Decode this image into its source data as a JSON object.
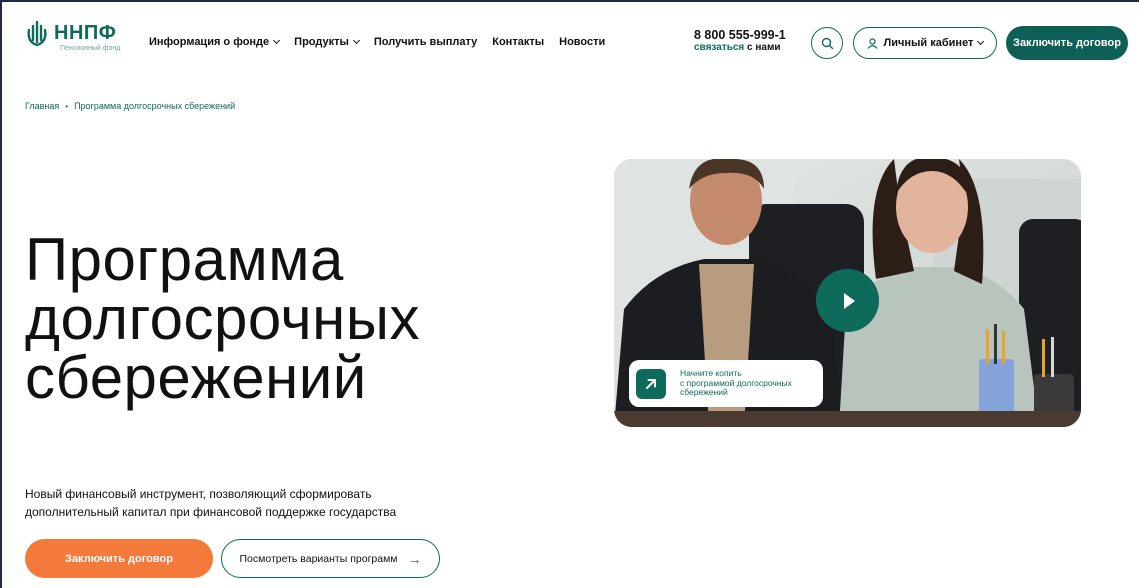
{
  "header": {
    "logo": {
      "name": "ННПФ",
      "subtitle": "Пенсионный фонд"
    },
    "nav": [
      {
        "label": "Информация о фонде",
        "has_dropdown": true
      },
      {
        "label": "Продукты",
        "has_dropdown": true
      },
      {
        "label": "Получить выплату",
        "has_dropdown": false
      },
      {
        "label": "Контакты",
        "has_dropdown": false
      },
      {
        "label": "Новости",
        "has_dropdown": false
      }
    ],
    "phone": "8 800 555-999-1",
    "contact_link_part1": "связаться",
    "contact_link_part2": " с нами",
    "search_icon": "search-icon",
    "cabinet_label": "Личный кабинет",
    "contract_label": "Заключить договор"
  },
  "breadcrumb": {
    "home": "Главная",
    "separator": "•",
    "current": "Программа долгосрочных сбережений"
  },
  "hero": {
    "title_line1": "Программа",
    "title_line2": "долгосрочных",
    "title_line3": "сбережений",
    "description_line1": "Новый финансовый инструмент, позволяющий сформировать",
    "description_line2": "дополнительный капитал при финансовой поддержке государства",
    "cta_primary": "Заключить договор",
    "cta_secondary": "Посмотреть варианты программ",
    "cta_secondary_arrow": "→"
  },
  "video": {
    "chip_line1": "Начните копить",
    "chip_line2": "с программой долгосрочных",
    "chip_line3": "сбережений"
  },
  "colors": {
    "brand_green": "#0e6b5b",
    "dark_green": "#0e5f55",
    "accent_orange": "#f47a3c"
  }
}
